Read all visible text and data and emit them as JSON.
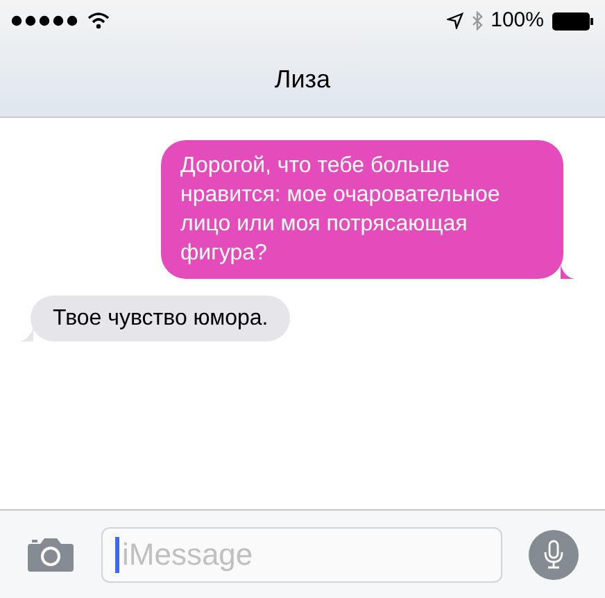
{
  "status_bar": {
    "battery": "100%"
  },
  "header": {
    "title": "Лиза"
  },
  "messages": [
    {
      "kind": "sent",
      "text": "Дорогой, что тебе больше нравится: мое очаровательное лицо или моя потрясающая фигура?"
    },
    {
      "kind": "received",
      "text": "Твое чувство юмора."
    }
  ],
  "composer": {
    "placeholder": "iMessage"
  }
}
